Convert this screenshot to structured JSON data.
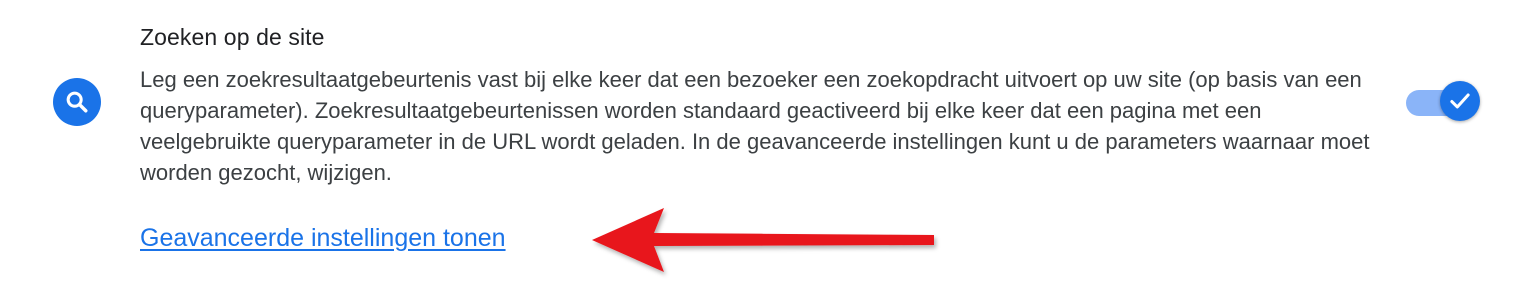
{
  "setting": {
    "title": "Zoeken op de site",
    "description": "Leg een zoekresultaatgebeurtenis vast bij elke keer dat een bezoeker een zoekopdracht uitvoert op uw site (op basis van een queryparameter). Zoekresultaatgebeurtenissen worden standaard geactiveerd bij elke keer dat een pagina met een veelgebruikte queryparameter in de URL wordt geladen. In de geavanceerde instellingen kunt u de parameters waarnaar moet worden gezocht, wijzigen.",
    "advanced_link": "Geavanceerde instellingen tonen",
    "icon": "search-icon",
    "toggle_state": "on"
  },
  "colors": {
    "accent": "#1a73e8",
    "toggle_track": "#8ab4f8",
    "arrow": "#e8141a",
    "text": "#3c4043"
  }
}
